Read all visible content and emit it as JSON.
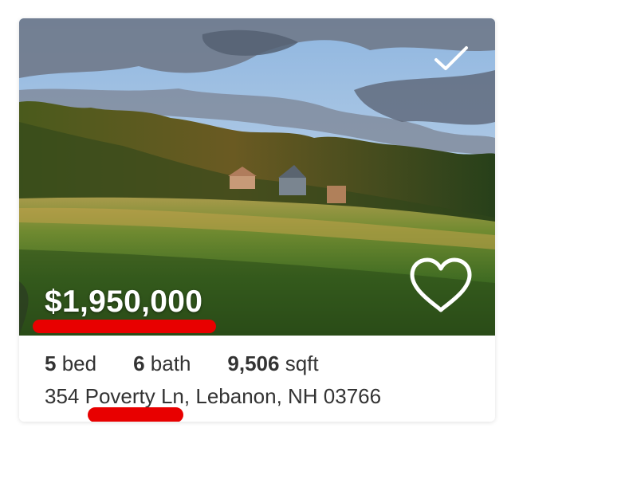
{
  "listing": {
    "price": "$1,950,000",
    "beds_value": "5",
    "beds_unit": "bed",
    "baths_value": "6",
    "baths_unit": "bath",
    "sqft_value": "9,506",
    "sqft_unit": "sqft",
    "address_number": "354 ",
    "address_street": "Poverty Ln",
    "address_rest": ", Lebanon, NH 03766"
  },
  "icons": {
    "selected": "check-icon",
    "favorite": "heart-outline-icon"
  },
  "colors": {
    "highlight": "#e80000",
    "text": "#333333",
    "icon_stroke": "#ffffff"
  }
}
